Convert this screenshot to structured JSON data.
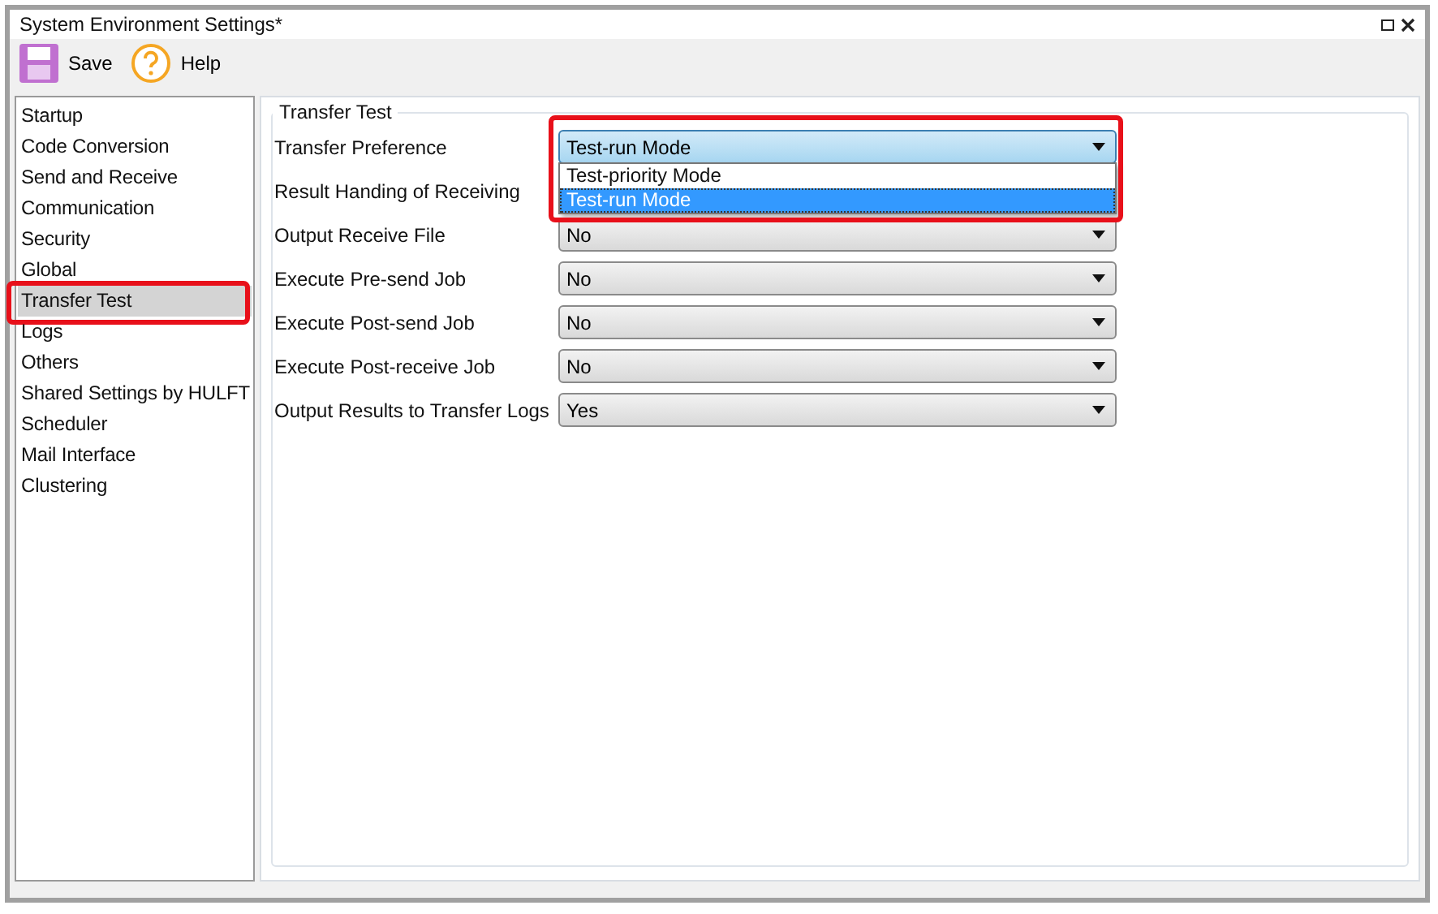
{
  "window": {
    "title": "System Environment Settings*"
  },
  "toolbar": [
    {
      "kind": "save",
      "label": "Save"
    },
    {
      "kind": "help",
      "label": "Help"
    }
  ],
  "sidebar": {
    "items": [
      {
        "label": "Startup",
        "selected": false,
        "highlighted": false
      },
      {
        "label": "Code Conversion",
        "selected": false,
        "highlighted": false
      },
      {
        "label": "Send and Receive",
        "selected": false,
        "highlighted": false
      },
      {
        "label": "Communication",
        "selected": false,
        "highlighted": false
      },
      {
        "label": "Security",
        "selected": false,
        "highlighted": false
      },
      {
        "label": "Global",
        "selected": false,
        "highlighted": false
      },
      {
        "label": "Transfer Test",
        "selected": true,
        "highlighted": true
      },
      {
        "label": "Logs",
        "selected": false,
        "highlighted": false
      },
      {
        "label": "Others",
        "selected": false,
        "highlighted": false
      },
      {
        "label": "Shared Settings by HULFT",
        "selected": false,
        "highlighted": false
      },
      {
        "label": "Scheduler",
        "selected": false,
        "highlighted": false
      },
      {
        "label": "Mail Interface",
        "selected": false,
        "highlighted": false
      },
      {
        "label": "Clustering",
        "selected": false,
        "highlighted": false
      }
    ]
  },
  "group": {
    "title": "Transfer Test",
    "settings": [
      {
        "label": "Transfer Preference",
        "value": "Test-run Mode",
        "expanded": true,
        "highlighted": true,
        "options": [
          {
            "label": "Test-priority Mode",
            "selected": false
          },
          {
            "label": "Test-run Mode",
            "selected": true
          }
        ]
      },
      {
        "label": "Result Handing of Receiving"
      },
      {
        "label": "Output Receive File",
        "value": "No",
        "expanded": false
      },
      {
        "label": "Execute Pre-send Job",
        "value": "No",
        "expanded": false
      },
      {
        "label": "Execute Post-send Job",
        "value": "No",
        "expanded": false
      },
      {
        "label": "Execute Post-receive Job",
        "value": "No",
        "expanded": false
      },
      {
        "label": "Output Results to Transfer Logs",
        "value": "Yes",
        "expanded": false
      }
    ]
  }
}
